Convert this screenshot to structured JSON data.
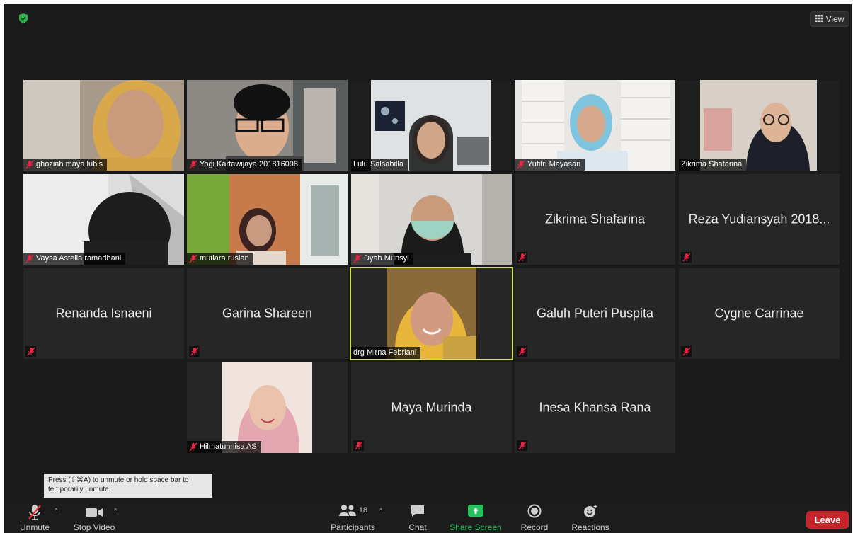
{
  "header": {
    "view_label": "View"
  },
  "tiles": [
    {
      "name": "ghoziah maya lubis",
      "video": true
    },
    {
      "name": "Yogi Kartawijaya 201816098",
      "video": true
    },
    {
      "name": "Lulu Salsabilla",
      "video": true
    },
    {
      "name": "Yufitri Mayasari",
      "video": true
    },
    {
      "name": "Zikrima Shafarina",
      "video": true
    },
    {
      "name": "Vaysa Astelia ramadhani",
      "video": true
    },
    {
      "name": "mutiara ruslan",
      "video": true
    },
    {
      "name": "Dyah Munsyi",
      "video": true
    },
    {
      "name": "Zikrima Shafarina",
      "video": false
    },
    {
      "name": "Reza Yudiansyah 2018...",
      "video": false
    },
    {
      "name": "Renanda Isnaeni",
      "video": false
    },
    {
      "name": "Garina Shareen",
      "video": false
    },
    {
      "name": "drg Mirna Febriani",
      "video": true,
      "active": true
    },
    {
      "name": "Galuh Puteri Puspita",
      "video": false
    },
    {
      "name": "Cygne Carrinae",
      "video": false
    },
    {
      "name": "Hilmatunnisa AS",
      "video": true
    },
    {
      "name": "Maya Murinda",
      "video": false
    },
    {
      "name": "Inesa Khansa Rana",
      "video": false
    }
  ],
  "tooltip": {
    "text": "Press (⇧⌘A) to unmute or hold space bar to temporarily unmute."
  },
  "toolbar": {
    "unmute": "Unmute",
    "stop_video": "Stop Video",
    "participants": "Participants",
    "participants_count": "18",
    "chat": "Chat",
    "share_screen": "Share Screen",
    "record": "Record",
    "reactions": "Reactions",
    "leave": "Leave"
  },
  "colors": {
    "active_border": "#d6e44c",
    "share_green": "#21c35a",
    "leave_red": "#c7252b",
    "shield_green": "#2fb54a"
  }
}
